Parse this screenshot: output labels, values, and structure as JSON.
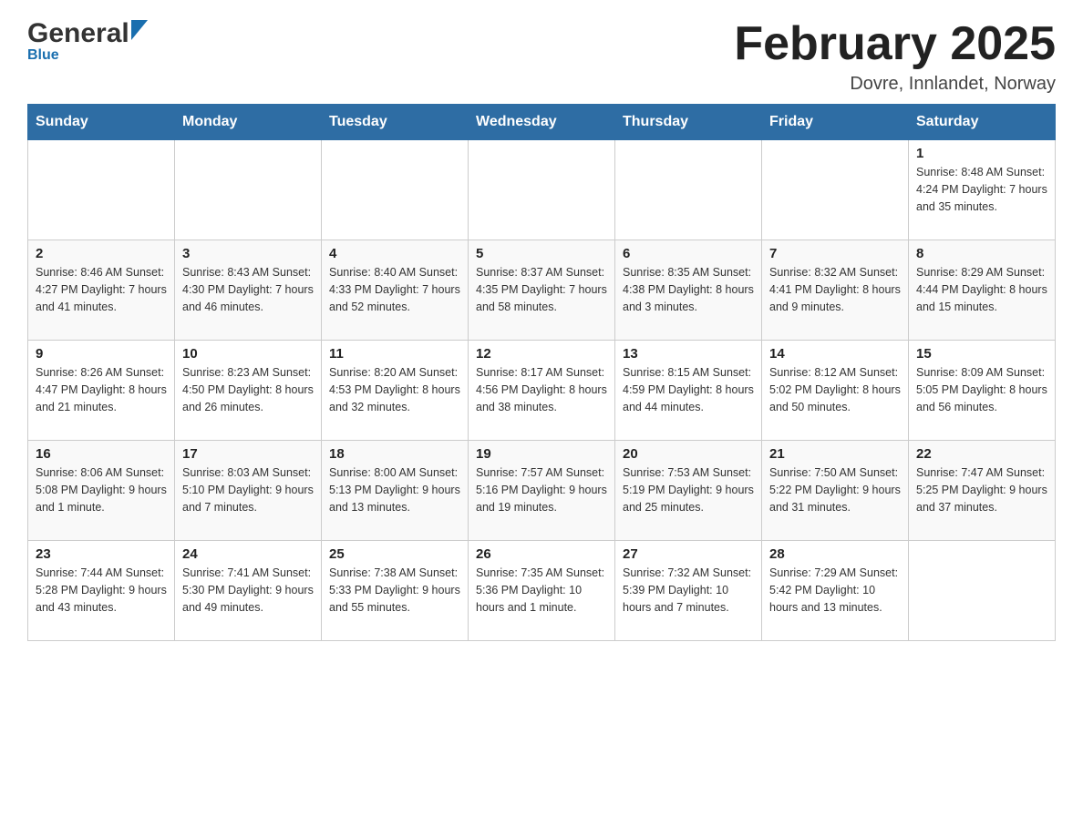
{
  "header": {
    "logo_general": "General",
    "logo_blue": "Blue",
    "month_title": "February 2025",
    "location": "Dovre, Innlandet, Norway"
  },
  "weekdays": [
    "Sunday",
    "Monday",
    "Tuesday",
    "Wednesday",
    "Thursday",
    "Friday",
    "Saturday"
  ],
  "weeks": [
    [
      {
        "day": "",
        "info": ""
      },
      {
        "day": "",
        "info": ""
      },
      {
        "day": "",
        "info": ""
      },
      {
        "day": "",
        "info": ""
      },
      {
        "day": "",
        "info": ""
      },
      {
        "day": "",
        "info": ""
      },
      {
        "day": "1",
        "info": "Sunrise: 8:48 AM\nSunset: 4:24 PM\nDaylight: 7 hours\nand 35 minutes."
      }
    ],
    [
      {
        "day": "2",
        "info": "Sunrise: 8:46 AM\nSunset: 4:27 PM\nDaylight: 7 hours\nand 41 minutes."
      },
      {
        "day": "3",
        "info": "Sunrise: 8:43 AM\nSunset: 4:30 PM\nDaylight: 7 hours\nand 46 minutes."
      },
      {
        "day": "4",
        "info": "Sunrise: 8:40 AM\nSunset: 4:33 PM\nDaylight: 7 hours\nand 52 minutes."
      },
      {
        "day": "5",
        "info": "Sunrise: 8:37 AM\nSunset: 4:35 PM\nDaylight: 7 hours\nand 58 minutes."
      },
      {
        "day": "6",
        "info": "Sunrise: 8:35 AM\nSunset: 4:38 PM\nDaylight: 8 hours\nand 3 minutes."
      },
      {
        "day": "7",
        "info": "Sunrise: 8:32 AM\nSunset: 4:41 PM\nDaylight: 8 hours\nand 9 minutes."
      },
      {
        "day": "8",
        "info": "Sunrise: 8:29 AM\nSunset: 4:44 PM\nDaylight: 8 hours\nand 15 minutes."
      }
    ],
    [
      {
        "day": "9",
        "info": "Sunrise: 8:26 AM\nSunset: 4:47 PM\nDaylight: 8 hours\nand 21 minutes."
      },
      {
        "day": "10",
        "info": "Sunrise: 8:23 AM\nSunset: 4:50 PM\nDaylight: 8 hours\nand 26 minutes."
      },
      {
        "day": "11",
        "info": "Sunrise: 8:20 AM\nSunset: 4:53 PM\nDaylight: 8 hours\nand 32 minutes."
      },
      {
        "day": "12",
        "info": "Sunrise: 8:17 AM\nSunset: 4:56 PM\nDaylight: 8 hours\nand 38 minutes."
      },
      {
        "day": "13",
        "info": "Sunrise: 8:15 AM\nSunset: 4:59 PM\nDaylight: 8 hours\nand 44 minutes."
      },
      {
        "day": "14",
        "info": "Sunrise: 8:12 AM\nSunset: 5:02 PM\nDaylight: 8 hours\nand 50 minutes."
      },
      {
        "day": "15",
        "info": "Sunrise: 8:09 AM\nSunset: 5:05 PM\nDaylight: 8 hours\nand 56 minutes."
      }
    ],
    [
      {
        "day": "16",
        "info": "Sunrise: 8:06 AM\nSunset: 5:08 PM\nDaylight: 9 hours\nand 1 minute."
      },
      {
        "day": "17",
        "info": "Sunrise: 8:03 AM\nSunset: 5:10 PM\nDaylight: 9 hours\nand 7 minutes."
      },
      {
        "day": "18",
        "info": "Sunrise: 8:00 AM\nSunset: 5:13 PM\nDaylight: 9 hours\nand 13 minutes."
      },
      {
        "day": "19",
        "info": "Sunrise: 7:57 AM\nSunset: 5:16 PM\nDaylight: 9 hours\nand 19 minutes."
      },
      {
        "day": "20",
        "info": "Sunrise: 7:53 AM\nSunset: 5:19 PM\nDaylight: 9 hours\nand 25 minutes."
      },
      {
        "day": "21",
        "info": "Sunrise: 7:50 AM\nSunset: 5:22 PM\nDaylight: 9 hours\nand 31 minutes."
      },
      {
        "day": "22",
        "info": "Sunrise: 7:47 AM\nSunset: 5:25 PM\nDaylight: 9 hours\nand 37 minutes."
      }
    ],
    [
      {
        "day": "23",
        "info": "Sunrise: 7:44 AM\nSunset: 5:28 PM\nDaylight: 9 hours\nand 43 minutes."
      },
      {
        "day": "24",
        "info": "Sunrise: 7:41 AM\nSunset: 5:30 PM\nDaylight: 9 hours\nand 49 minutes."
      },
      {
        "day": "25",
        "info": "Sunrise: 7:38 AM\nSunset: 5:33 PM\nDaylight: 9 hours\nand 55 minutes."
      },
      {
        "day": "26",
        "info": "Sunrise: 7:35 AM\nSunset: 5:36 PM\nDaylight: 10 hours\nand 1 minute."
      },
      {
        "day": "27",
        "info": "Sunrise: 7:32 AM\nSunset: 5:39 PM\nDaylight: 10 hours\nand 7 minutes."
      },
      {
        "day": "28",
        "info": "Sunrise: 7:29 AM\nSunset: 5:42 PM\nDaylight: 10 hours\nand 13 minutes."
      },
      {
        "day": "",
        "info": ""
      }
    ]
  ]
}
